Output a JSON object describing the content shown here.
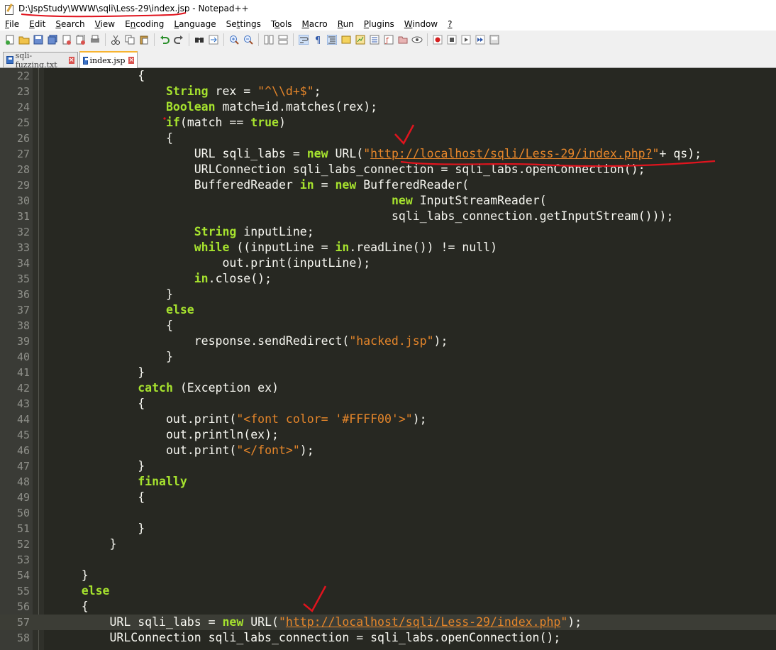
{
  "window": {
    "title": "D:\\JspStudy\\WWW\\sqli\\Less-29\\index.jsp - Notepad++"
  },
  "menu": [
    "File",
    "Edit",
    "Search",
    "View",
    "Encoding",
    "Language",
    "Settings",
    "Tools",
    "Macro",
    "Run",
    "Plugins",
    "Window",
    "?"
  ],
  "menu_underline": [
    "F",
    "E",
    "S",
    "V",
    "n",
    "L",
    "t",
    "o",
    "M",
    "R",
    "P",
    "W",
    "?"
  ],
  "tabs": [
    {
      "label": "sqli-fuzzing.txt",
      "active": false
    },
    {
      "label": "index.jsp",
      "active": true
    }
  ],
  "colors": {
    "editor_bg": "#272822",
    "keyword": "#a6e22e",
    "string": "#e6862a",
    "annotation": "#e0141e"
  },
  "code_lines": [
    {
      "n": "22",
      "text": "            {"
    },
    {
      "n": "23",
      "text": "                String rex = \"^\\\\d+$\";"
    },
    {
      "n": "24",
      "text": "                Boolean match=id.matches(rex);"
    },
    {
      "n": "25",
      "text": "                if(match == true)"
    },
    {
      "n": "26",
      "text": "                {"
    },
    {
      "n": "27",
      "text": "                    URL sqli_labs = new URL(\"http://localhost/sqli/Less-29/index.php?\"+ qs);"
    },
    {
      "n": "28",
      "text": "                    URLConnection sqli_labs_connection = sqli_labs.openConnection();"
    },
    {
      "n": "29",
      "text": "                    BufferedReader in = new BufferedReader("
    },
    {
      "n": "30",
      "text": "                                                new InputStreamReader("
    },
    {
      "n": "31",
      "text": "                                                sqli_labs_connection.getInputStream()));"
    },
    {
      "n": "32",
      "text": "                    String inputLine;"
    },
    {
      "n": "33",
      "text": "                    while ((inputLine = in.readLine()) != null)"
    },
    {
      "n": "34",
      "text": "                        out.print(inputLine);"
    },
    {
      "n": "35",
      "text": "                    in.close();"
    },
    {
      "n": "36",
      "text": "                }"
    },
    {
      "n": "37",
      "text": "                else"
    },
    {
      "n": "38",
      "text": "                {"
    },
    {
      "n": "39",
      "text": "                    response.sendRedirect(\"hacked.jsp\");"
    },
    {
      "n": "40",
      "text": "                }"
    },
    {
      "n": "41",
      "text": "            }"
    },
    {
      "n": "42",
      "text": "            catch (Exception ex)"
    },
    {
      "n": "43",
      "text": "            {"
    },
    {
      "n": "44",
      "text": "                out.print(\"<font color= '#FFFF00'>\");"
    },
    {
      "n": "45",
      "text": "                out.println(ex);"
    },
    {
      "n": "46",
      "text": "                out.print(\"</font>\");"
    },
    {
      "n": "47",
      "text": "            }"
    },
    {
      "n": "48",
      "text": "            finally"
    },
    {
      "n": "49",
      "text": "            {"
    },
    {
      "n": "50",
      "text": ""
    },
    {
      "n": "51",
      "text": "            }"
    },
    {
      "n": "52",
      "text": "        }"
    },
    {
      "n": "53",
      "text": ""
    },
    {
      "n": "54",
      "text": "    }"
    },
    {
      "n": "55",
      "text": "    else"
    },
    {
      "n": "56",
      "text": "    {"
    },
    {
      "n": "57",
      "text": "        URL sqli_labs = new URL(\"http://localhost/sqli/Less-29/index.php\");"
    },
    {
      "n": "58",
      "text": "        URLConnection sqli_labs_connection = sqli_labs.openConnection();"
    }
  ],
  "current_line": "57",
  "keywords": [
    "String",
    "Boolean",
    "if",
    "true",
    "new",
    "in",
    "while",
    "else",
    "catch",
    "finally"
  ]
}
